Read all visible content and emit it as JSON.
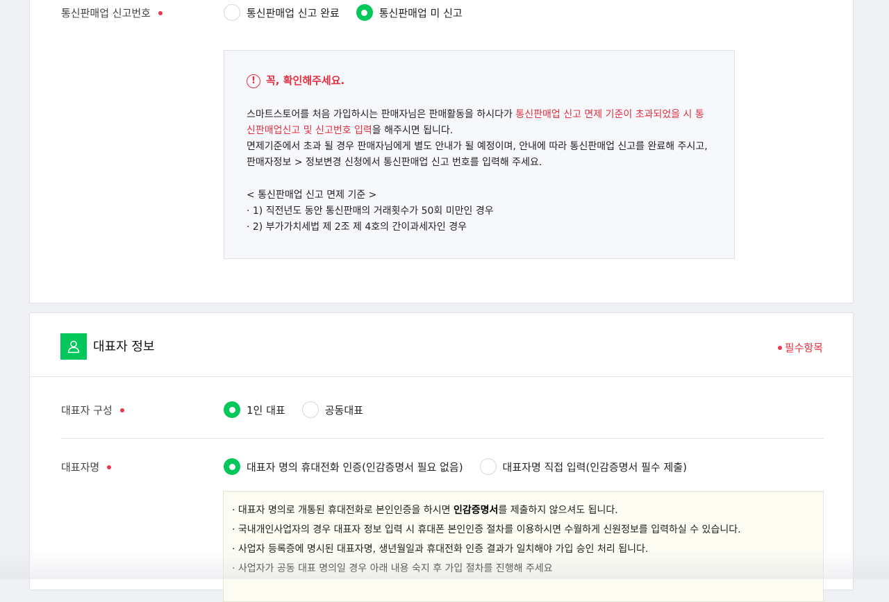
{
  "business_report": {
    "label": "통신판매업 신고번호",
    "options": [
      {
        "label": "통신판매업 신고 완료",
        "selected": false
      },
      {
        "label": "통신판매업 미 신고",
        "selected": true
      }
    ],
    "notice": {
      "title": "꼭, 확인해주세요.",
      "p1_a": "스마트스토어를 처음 가입하시는 판매자님은 판매활동을 하시다가 ",
      "p1_red": "통신판매업 신고 면제 기준이 초과되었을 시 통신판매업신고 및 신고번호 입력",
      "p1_b": "을 해주시면 됩니다.",
      "p2": "면제기준에서 초과 될 경우 판매자님에게 별도 안내가 될 예정이며, 안내에 따라 통신판매업 신고를 완료해 주시고,",
      "p3": "판매자정보 > 정보변경 신청에서 통신판매업 신고 번호를 입력해 주세요.",
      "criteria_title": "< 통신판매업 신고 면제 기준 >",
      "criteria_1": "· 1) 직전년도 동안 통신판매의 거래횟수가 50회 미만인 경우",
      "criteria_2": "· 2) 부가가치세법 제 2조 제 4호의 간이과세자인 경우"
    }
  },
  "representative": {
    "section_title": "대표자 정보",
    "required_legend": "필수항목",
    "composition": {
      "label": "대표자 구성",
      "options": [
        {
          "label": "1인 대표",
          "selected": true
        },
        {
          "label": "공동대표",
          "selected": false
        }
      ]
    },
    "name": {
      "label": "대표자명",
      "options": [
        {
          "label": "대표자 명의 휴대전화 인증(인감증명서 필요 없음)",
          "selected": true
        },
        {
          "label": "대표자명 직접 입력(인감증명서 필수 제출)",
          "selected": false
        }
      ]
    },
    "info": {
      "line1_a": "· 대표자 명의로 개통된 휴대전화로 본인인증을 하시면 ",
      "line1_bold": "인감증명서",
      "line1_b": "를 제출하지 않으셔도 됩니다.",
      "line2": "· 국내개인사업자의 경우 대표자 정보 입력 시 휴대폰 본인인증 절차를 이용하시면 수월하게 신원정보를 입력하실 수 있습니다.",
      "line3": "· 사업자 등록증에 명시된 대표자명, 생년월일과 휴대전화 인증 결과가 일치해야 가입 승인 처리 됩니다.",
      "line4": "· 사업자가 공동 대표 명의일 경우 아래 내용 숙지 후 가입 절차를 진행해 주세요"
    }
  },
  "colors": {
    "accent": "#03c75a",
    "required": "#e4303e"
  }
}
